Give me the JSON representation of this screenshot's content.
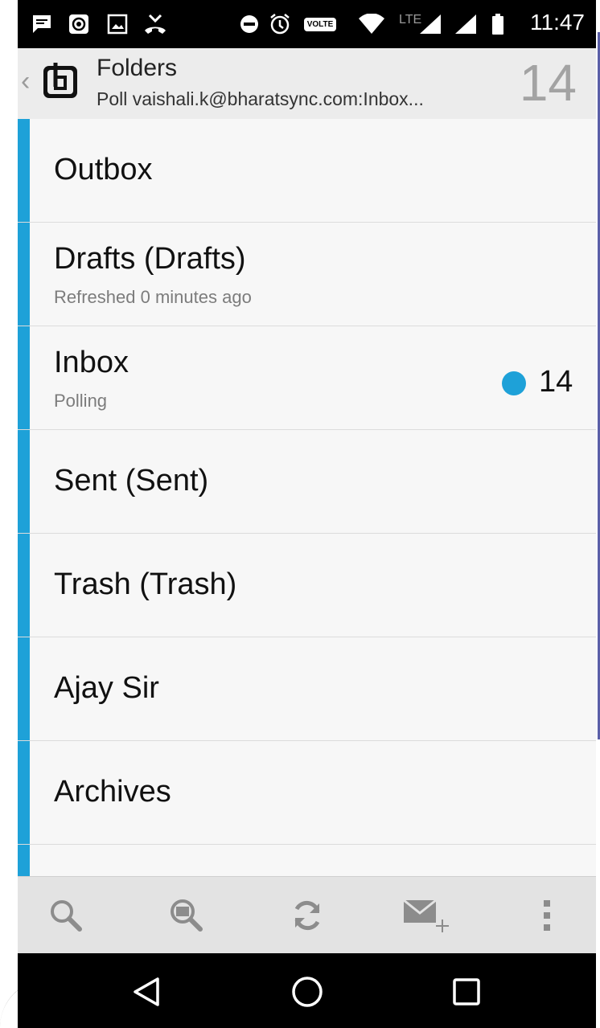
{
  "status_bar": {
    "time": "11:47",
    "network": "LTE",
    "volte": "VOLTE",
    "icons": [
      "message-icon",
      "photo-icon",
      "image-icon",
      "missed-call-icon",
      "dnd-icon",
      "alarm-icon",
      "volte-icon",
      "wifi-icon",
      "signal-icon",
      "signal-icon",
      "battery-icon"
    ]
  },
  "app_bar": {
    "title": "Folders",
    "subtitle": "Poll vaishali.k@bharatsync.com:Inbox...",
    "count": "14",
    "back_icon": "chevron-left-icon",
    "logo_icon": "app-logo-icon"
  },
  "folders": [
    {
      "name": "Outbox",
      "status": ""
    },
    {
      "name": "Drafts (Drafts)",
      "status": "Refreshed 0 minutes ago"
    },
    {
      "name": "Inbox",
      "status": "Polling",
      "unread": "14"
    },
    {
      "name": "Sent (Sent)",
      "status": ""
    },
    {
      "name": "Trash (Trash)",
      "status": ""
    },
    {
      "name": "Ajay Sir",
      "status": ""
    },
    {
      "name": "Archives",
      "status": ""
    }
  ],
  "toolbar": {
    "icons": [
      "search-icon",
      "search-messages-icon",
      "refresh-icon",
      "compose-icon",
      "overflow-menu-icon"
    ]
  },
  "nav_bar": {
    "icons": [
      "back-triangle-icon",
      "home-circle-icon",
      "recents-square-icon"
    ]
  },
  "colors": {
    "accent": "#1ea1d8",
    "app_bar_bg": "#ececec",
    "list_bg": "#f7f7f7",
    "toolbar_bg": "#e3e3e3"
  }
}
